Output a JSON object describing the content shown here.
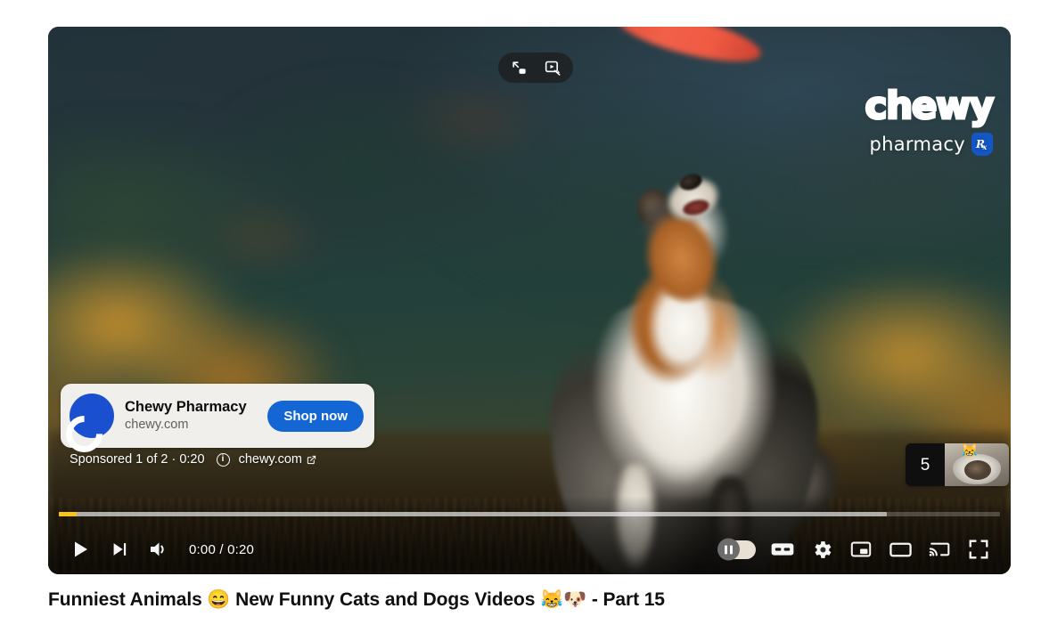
{
  "page": {
    "background_color": "#ffffff"
  },
  "player": {
    "state": "ad-playing",
    "overlay_buttons": [
      {
        "name": "miniplayer-icon",
        "label": "Miniplayer"
      },
      {
        "name": "enhance-video-icon",
        "label": "Enhance video"
      }
    ],
    "brand_overlay": {
      "word": "chewy",
      "sub": "pharmacy",
      "rx_badge": "R",
      "rx_badge_sub": "x"
    },
    "ad_card": {
      "advertiser": "Chewy Pharmacy",
      "domain": "chewy.com",
      "cta_label": "Shop now",
      "avatar_letter": "C",
      "avatar_color": "#1a4fd0",
      "cta_color": "#1466d5",
      "card_color": "#f1efec"
    },
    "ad_meta": {
      "sponsored_text": "Sponsored 1 of 2 · 0:20",
      "info_glyph": "i",
      "visit_link": "chewy.com",
      "external_glyph": "↗"
    },
    "countdown": {
      "seconds": "5",
      "thumbnail_emoji": "😹"
    },
    "progress": {
      "played_percent": 1.9,
      "loaded_percent": 88,
      "played_color": "#f8c419",
      "loaded_color": "rgba(255,255,255,.55)",
      "track_color": "rgba(255,255,255,.22)"
    },
    "controls": {
      "play_label": "Play",
      "next_label": "Next",
      "volume_label": "Mute",
      "time_display": "0:00 / 0:20",
      "current_time": "0:00",
      "duration": "0:20",
      "autoplay_label": "Autoplay is on",
      "autoplay_on": true,
      "captions_label": "CC",
      "settings_label": "Settings",
      "miniplayer_label": "Miniplayer",
      "theater_label": "Theater mode",
      "cast_label": "Play on TV",
      "fullscreen_label": "Full screen"
    }
  },
  "video": {
    "title": "Funniest Animals 😄 New Funny Cats and Dogs Videos 😹🐶 - Part 15"
  }
}
